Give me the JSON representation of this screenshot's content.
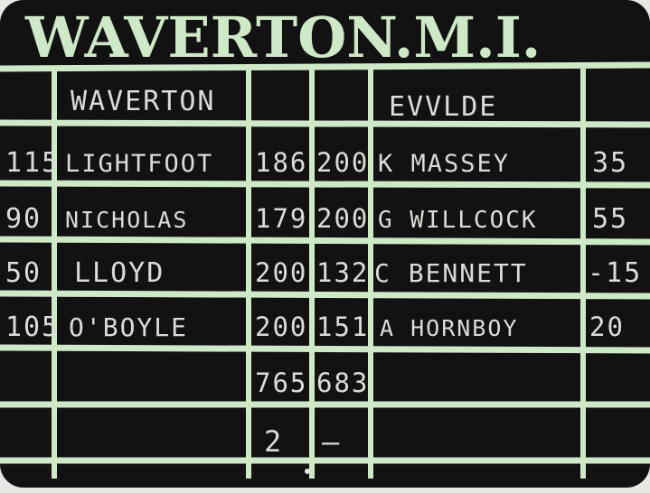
{
  "title": "WAVERTON.M.I.",
  "headers": {
    "home_team": "WAVERTON",
    "away_team": "EVVLDE"
  },
  "rows": [
    {
      "handicap": "115",
      "home_player": "LIGHTFOOT",
      "home_score": "186",
      "away_score": "200",
      "away_player": "K MASSEY",
      "away_handicap": "35"
    },
    {
      "handicap": "90",
      "home_player": "NICHOLAS",
      "home_score": "179",
      "away_score": "200",
      "away_player": "G WILLCOCK",
      "away_handicap": "55"
    },
    {
      "handicap": "50",
      "home_player": "LLOYD",
      "home_score": "200",
      "away_score": "132",
      "away_player": "C BENNETT",
      "away_handicap": "-15"
    },
    {
      "handicap": "105",
      "home_player": "O'BOYLE",
      "home_score": "200",
      "away_score": "151",
      "away_player": "A HORNBOY",
      "away_handicap": "20"
    }
  ],
  "totals": {
    "home": "765",
    "away": "683"
  },
  "points": {
    "home": "2",
    "away": "—"
  },
  "colors": {
    "board": "#111111",
    "lines": "#cfe8c8",
    "chalk": "#d9ddd7",
    "title": "#cfe8c8"
  }
}
